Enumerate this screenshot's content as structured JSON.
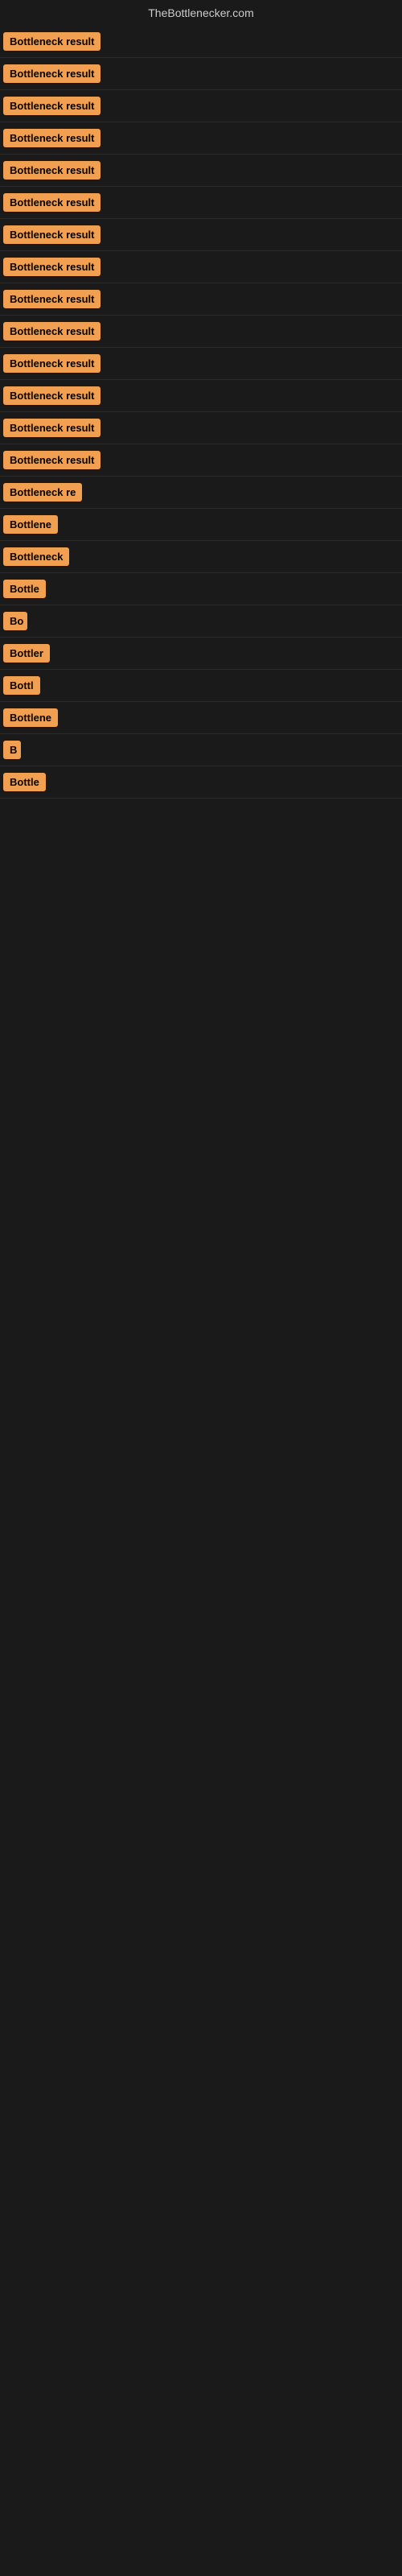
{
  "site_title": "TheBottlenecker.com",
  "badges": [
    {
      "id": 1,
      "text": "Bottleneck result",
      "visible_width": 165
    },
    {
      "id": 2,
      "text": "Bottleneck result",
      "visible_width": 165
    },
    {
      "id": 3,
      "text": "Bottleneck result",
      "visible_width": 165
    },
    {
      "id": 4,
      "text": "Bottleneck result",
      "visible_width": 163
    },
    {
      "id": 5,
      "text": "Bottleneck result",
      "visible_width": 163
    },
    {
      "id": 6,
      "text": "Bottleneck result",
      "visible_width": 162
    },
    {
      "id": 7,
      "text": "Bottleneck result",
      "visible_width": 160
    },
    {
      "id": 8,
      "text": "Bottleneck result",
      "visible_width": 160
    },
    {
      "id": 9,
      "text": "Bottleneck result",
      "visible_width": 158
    },
    {
      "id": 10,
      "text": "Bottleneck result",
      "visible_width": 158
    },
    {
      "id": 11,
      "text": "Bottleneck result",
      "visible_width": 157
    },
    {
      "id": 12,
      "text": "Bottleneck result",
      "visible_width": 155
    },
    {
      "id": 13,
      "text": "Bottleneck result",
      "visible_width": 153
    },
    {
      "id": 14,
      "text": "Bottleneck result",
      "visible_width": 150
    },
    {
      "id": 15,
      "text": "Bottleneck re",
      "visible_width": 110
    },
    {
      "id": 16,
      "text": "Bottlene",
      "visible_width": 80
    },
    {
      "id": 17,
      "text": "Bottleneck",
      "visible_width": 90
    },
    {
      "id": 18,
      "text": "Bottle",
      "visible_width": 65
    },
    {
      "id": 19,
      "text": "Bo",
      "visible_width": 30
    },
    {
      "id": 20,
      "text": "Bottler",
      "visible_width": 68
    },
    {
      "id": 21,
      "text": "Bottl",
      "visible_width": 55
    },
    {
      "id": 22,
      "text": "Bottlene",
      "visible_width": 80
    },
    {
      "id": 23,
      "text": "B",
      "visible_width": 22
    },
    {
      "id": 24,
      "text": "Bottle",
      "visible_width": 65
    }
  ],
  "colors": {
    "badge_bg": "#f0a050",
    "badge_text": "#000000",
    "background": "#1a1a1a",
    "site_title": "#cccccc"
  }
}
